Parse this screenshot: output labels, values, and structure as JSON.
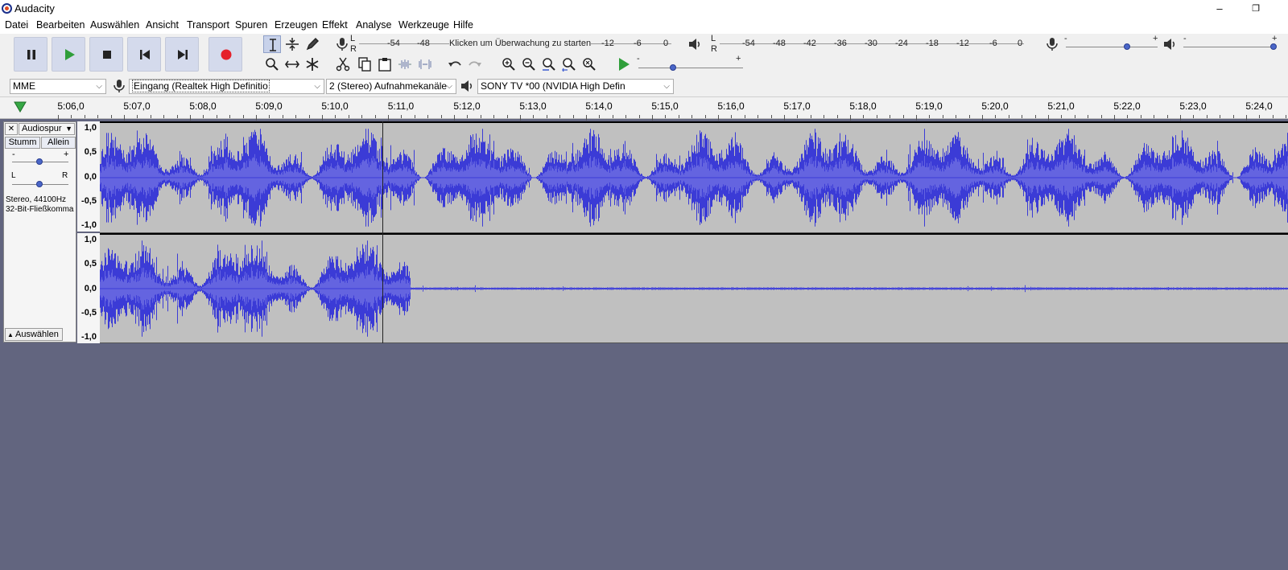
{
  "window": {
    "title": "Audacity",
    "minimize": "–",
    "restore": "❐"
  },
  "menu": [
    "Datei",
    "Bearbeiten",
    "Auswählen",
    "Ansicht",
    "Transport",
    "Spuren",
    "Erzeugen",
    "Effekt",
    "Analyse",
    "Werkzeuge",
    "Hilfe"
  ],
  "transport": [
    {
      "name": "pause-button",
      "icon": "pause-icon"
    },
    {
      "name": "play-button",
      "icon": "play-icon"
    },
    {
      "name": "stop-button",
      "icon": "stop-icon"
    },
    {
      "name": "skip-start-button",
      "icon": "skip-start-icon"
    },
    {
      "name": "skip-end-button",
      "icon": "skip-end-icon"
    },
    {
      "name": "record-button",
      "icon": "record-icon"
    }
  ],
  "meters": {
    "rec_lr": [
      "L",
      "R"
    ],
    "rec_ticks": [
      "-54",
      "-48"
    ],
    "rec_ticks_right": [
      "-12",
      "-6",
      "0"
    ],
    "rec_prompt": "Klicken um Überwachung zu starten",
    "play_lr": [
      "L",
      "R"
    ],
    "play_ticks": [
      "-54",
      "-48",
      "-42",
      "-36",
      "-30",
      "-24",
      "-18",
      "-12",
      "-6",
      "0"
    ]
  },
  "mixer": {
    "rec_minus": "-",
    "rec_plus": "+",
    "play_minus": "-",
    "play_plus": "+",
    "speed_minus": "-",
    "speed_plus": "+"
  },
  "devices": {
    "host": "MME",
    "input": "Eingang (Realtek High Definitio",
    "channels": "2 (Stereo) Aufnahmekanäle",
    "output": "SONY TV  *00 (NVIDIA High Defin"
  },
  "timeline": [
    "5:06,0",
    "5:07,0",
    "5:08,0",
    "5:09,0",
    "5:10,0",
    "5:11,0",
    "5:12,0",
    "5:13,0",
    "5:14,0",
    "5:15,0",
    "5:16,0",
    "5:17,0",
    "5:18,0",
    "5:19,0",
    "5:20,0",
    "5:21,0",
    "5:22,0",
    "5:23,0",
    "5:24,0"
  ],
  "track": {
    "close": "✕",
    "name": "Audiospur",
    "mute": "Stumm",
    "solo": "Allein",
    "gain_minus": "-",
    "gain_plus": "+",
    "pan_left": "L",
    "pan_right": "R",
    "info1": "Stereo, 44100Hz",
    "info2": "32-Bit-Fließkomma",
    "select": "Auswählen"
  },
  "scale": [
    "1,0",
    "0,5",
    "0,0",
    "-0,5",
    "-1,0"
  ],
  "colors": {
    "wave": "#3b3bd6",
    "wave_rms": "#6464e0",
    "track_bg": "#c0c0c0",
    "record": "#e5202a",
    "play": "#2f9e3a",
    "empty": "#62657f"
  }
}
